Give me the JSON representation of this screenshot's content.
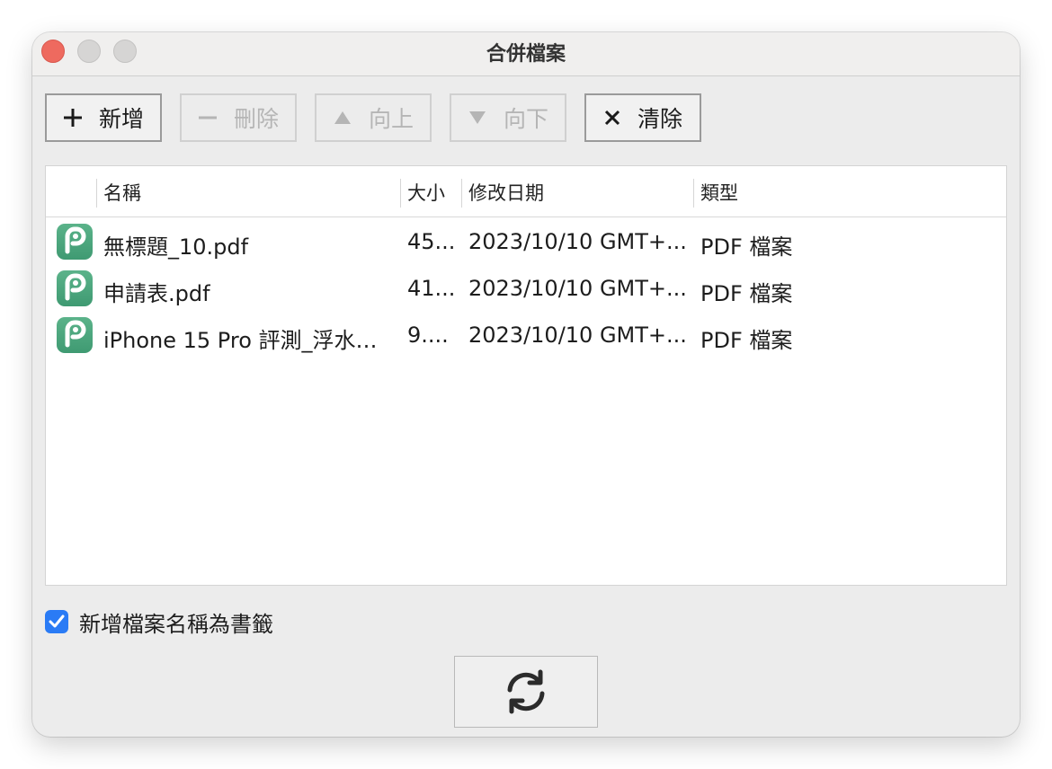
{
  "window": {
    "title": "合併檔案"
  },
  "toolbar": {
    "add_label": "新增",
    "delete_label": "刪除",
    "up_label": "向上",
    "down_label": "向下",
    "clear_label": "清除"
  },
  "table": {
    "columns": [
      "名稱",
      "大小",
      "修改日期",
      "類型"
    ],
    "rows": [
      {
        "name": "無標題_10.pdf",
        "size": "45...",
        "date": "2023/10/10 GMT+...",
        "type": "PDF 檔案"
      },
      {
        "name": "申請表.pdf",
        "size": "41...",
        "date": "2023/10/10 GMT+...",
        "type": "PDF 檔案"
      },
      {
        "name": "iPhone 15 Pro 評測_浮水…",
        "size": "9....",
        "date": "2023/10/10 GMT+...",
        "type": "PDF 檔案"
      }
    ]
  },
  "options": {
    "bookmark_label": "新增檔案名稱為書籤",
    "bookmark_checked": true
  },
  "icons": {
    "close": "close-traffic-light",
    "add": "plus-icon",
    "delete": "minus-icon",
    "up": "triangle-up-icon",
    "down": "triangle-down-icon",
    "clear": "x-icon",
    "file": "pdf-app-icon",
    "merge": "refresh-arrows-icon"
  },
  "colors": {
    "accent": "#2a7bf5",
    "close_light": "#ee6a5f",
    "file_icon": "#4aa67c"
  }
}
